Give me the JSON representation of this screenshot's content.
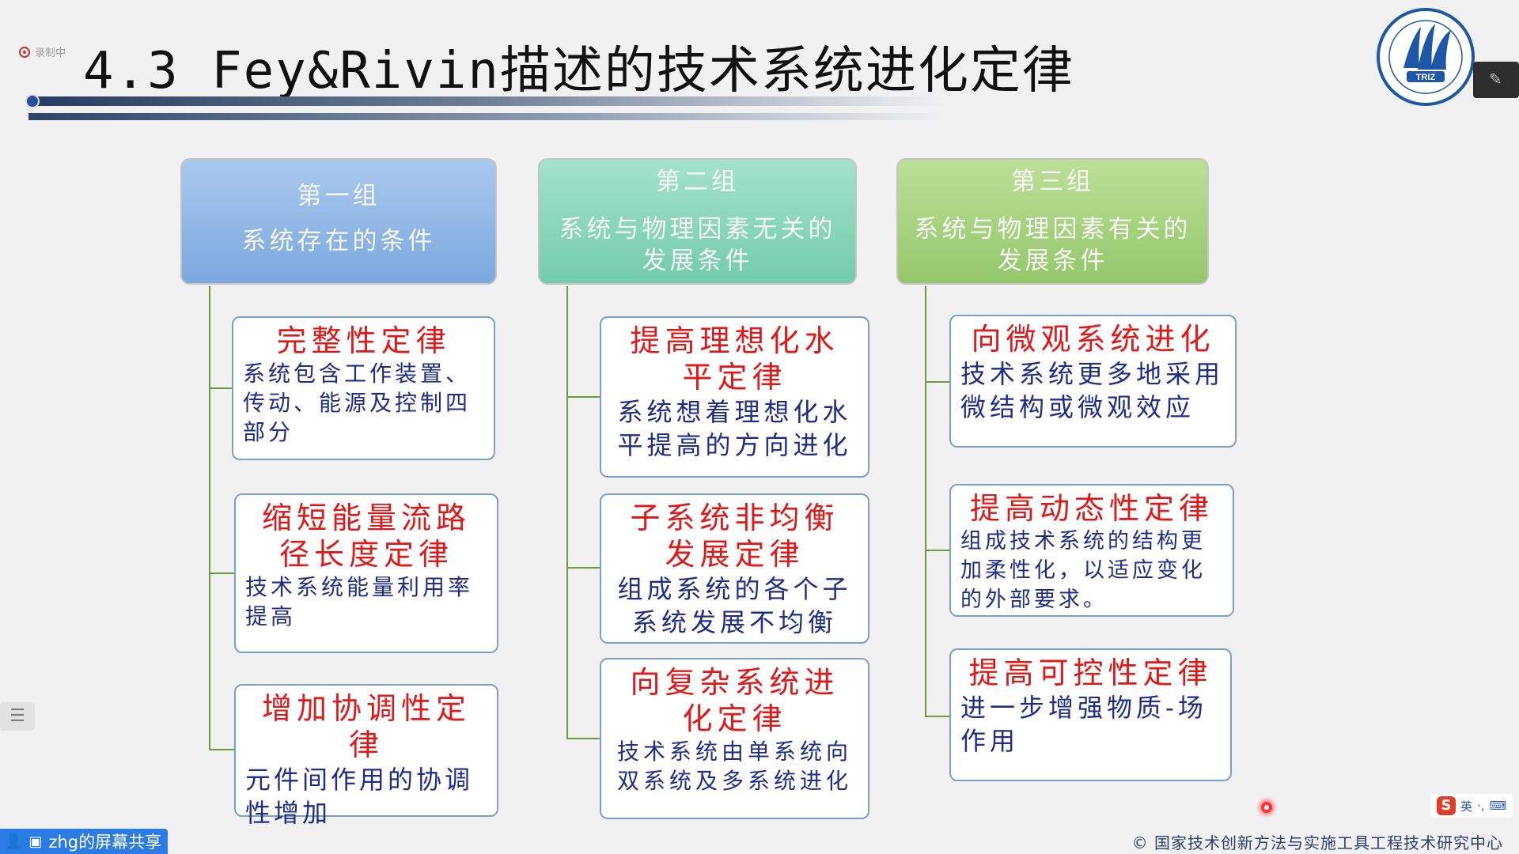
{
  "recording": {
    "label": "录制中"
  },
  "slide": {
    "title": "4.3 Fey&Rivin描述的技术系统进化定律"
  },
  "logo": {
    "text": "TRIZ",
    "icon": "triz-logo"
  },
  "groups": [
    {
      "name": "第一组",
      "theme": "系统存在的条件",
      "color": "#7ba8de",
      "laws": [
        {
          "name": "完整性定律",
          "desc": "系统包含工作装置、传动、能源及控制四部分"
        },
        {
          "name": "缩短能量流路径长度定律",
          "desc": "技术系统能量利用率提高"
        },
        {
          "name": "增加协调性定律",
          "desc": "元件间作用的协调性增加"
        }
      ]
    },
    {
      "name": "第二组",
      "theme": "系统与物理因素无关的发展条件",
      "color": "#72ccab",
      "laws": [
        {
          "name": "提高理想化水平定律",
          "desc": "系统想着理想化水平提高的方向进化"
        },
        {
          "name": "子系统非均衡发展定律",
          "desc": "组成系统的各个子系统发展不均衡"
        },
        {
          "name": "向复杂系统进化定律",
          "desc": "技术系统由单系统向双系统及多系统进化"
        }
      ]
    },
    {
      "name": "第三组",
      "theme": "系统与物理因素有关的发展条件",
      "color": "#94c76a",
      "laws": [
        {
          "name": "向微观系统进化",
          "desc": "技术系统更多地采用微结构或微观效应"
        },
        {
          "name": "提高动态性定律",
          "desc": "组成技术系统的结构更加柔性化，以适应变化的外部要求。"
        },
        {
          "name": "提高可控性定律",
          "desc": "进一步增强物质-场作用"
        }
      ]
    }
  ],
  "footer": {
    "share_label": "zhg的屏幕共享",
    "copyright": "© 国家技术创新方法与实施工具工程技术研究中心",
    "ime_lang": "英"
  }
}
